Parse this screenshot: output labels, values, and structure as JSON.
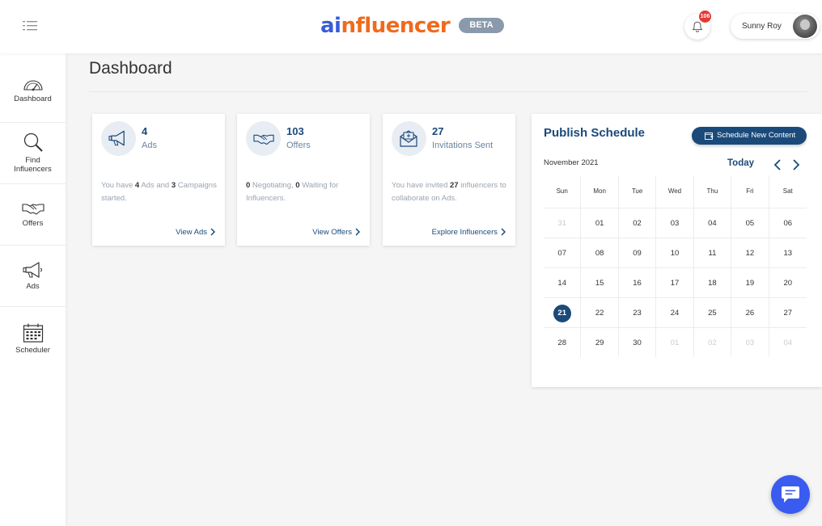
{
  "header": {
    "logo_ai": "ai",
    "logo_rest": "nfluencer",
    "beta_label": "BETA",
    "notification_count": "106",
    "user_name": "Sunny Roy",
    "icons": {
      "menu": "menu-toggle-icon",
      "bell": "bell-icon",
      "avatar": "avatar"
    }
  },
  "sidebar": {
    "items": [
      {
        "label": "Dashboard",
        "icon": "speedometer-icon"
      },
      {
        "label": "Find Influencers",
        "icon": "search-icon"
      },
      {
        "label": "Offers",
        "icon": "handshake-icon"
      },
      {
        "label": "Ads",
        "icon": "megaphone-icon"
      },
      {
        "label": "Scheduler",
        "icon": "calendar-icon"
      }
    ]
  },
  "main": {
    "title": "Dashboard",
    "cards": [
      {
        "value": "4",
        "label": "Ads",
        "desc_pre": "You have ",
        "desc_n1": "4",
        "desc_mid": " Ads and ",
        "desc_n2": "3",
        "desc_post": " Campaigns started.",
        "link": "View Ads",
        "icon": "megaphone-icon"
      },
      {
        "value": "103",
        "label": "Offers",
        "desc_pre": "",
        "desc_n1": "0",
        "desc_mid": " Negotiating, ",
        "desc_n2": "0",
        "desc_post": " Waiting for Influencers.",
        "link": "View Offers",
        "icon": "handshake-icon"
      },
      {
        "value": "27",
        "label": "Invitations Sent",
        "desc_pre": "You have invited ",
        "desc_n1": "27",
        "desc_mid": " influencers to collaborate on Ads.",
        "desc_n2": "",
        "desc_post": "",
        "link": "Explore Influencers",
        "icon": "envelope-icon"
      }
    ]
  },
  "schedule": {
    "title": "Publish Schedule",
    "button_label": "Schedule New Content",
    "month": "November 2021",
    "today_label": "Today",
    "weekdays": [
      "Sun",
      "Mon",
      "Tue",
      "Wed",
      "Thu",
      "Fri",
      "Sat"
    ],
    "weeks": [
      [
        {
          "d": "31",
          "muted": true
        },
        {
          "d": "01"
        },
        {
          "d": "02"
        },
        {
          "d": "03"
        },
        {
          "d": "04"
        },
        {
          "d": "05"
        },
        {
          "d": "06"
        }
      ],
      [
        {
          "d": "07"
        },
        {
          "d": "08"
        },
        {
          "d": "09"
        },
        {
          "d": "10"
        },
        {
          "d": "11"
        },
        {
          "d": "12"
        },
        {
          "d": "13"
        }
      ],
      [
        {
          "d": "14"
        },
        {
          "d": "15"
        },
        {
          "d": "16"
        },
        {
          "d": "17"
        },
        {
          "d": "18"
        },
        {
          "d": "19"
        },
        {
          "d": "20"
        }
      ],
      [
        {
          "d": "21",
          "selected": true
        },
        {
          "d": "22"
        },
        {
          "d": "23"
        },
        {
          "d": "24"
        },
        {
          "d": "25"
        },
        {
          "d": "26"
        },
        {
          "d": "27"
        }
      ],
      [
        {
          "d": "28"
        },
        {
          "d": "29"
        },
        {
          "d": "30"
        },
        {
          "d": "01",
          "muted": true
        },
        {
          "d": "02",
          "muted": true
        },
        {
          "d": "03",
          "muted": true
        },
        {
          "d": "04",
          "muted": true
        }
      ]
    ]
  },
  "colors": {
    "brand_blue": "#3a5bd9",
    "brand_orange": "#f06a1c",
    "navy": "#1a4a7a",
    "badge_red": "#e53935",
    "chat_blue": "#3a5bf0"
  }
}
